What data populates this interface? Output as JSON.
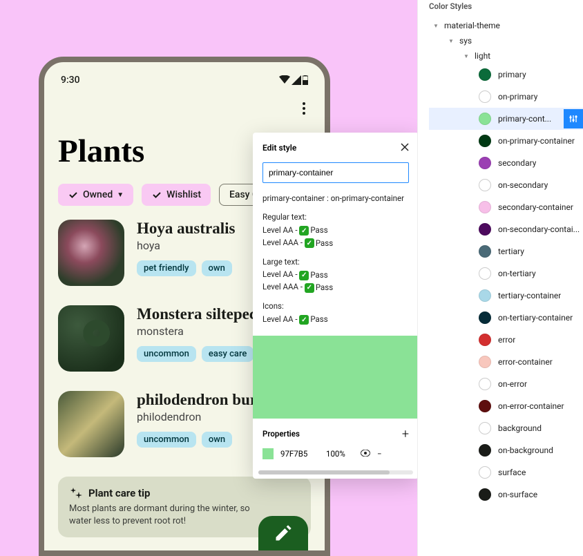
{
  "phone": {
    "time": "9:30",
    "title": "Plants",
    "chips": {
      "owned": "Owned",
      "wishlist": "Wishlist",
      "easy": "Easy C"
    },
    "items": [
      {
        "title": "Hoya australis",
        "sub": "hoya",
        "tags": [
          "pet friendly",
          "own"
        ]
      },
      {
        "title": "Monstera siltepeca",
        "sub": "monstera",
        "tags": [
          "uncommon",
          "easy care"
        ]
      },
      {
        "title": "philodendron bur",
        "sub": "philodendron",
        "tags": [
          "uncommon",
          "own"
        ]
      }
    ],
    "tip": {
      "head": "Plant care tip",
      "body": "Most plants are dormant during the winter, so water less to prevent root rot!"
    }
  },
  "panel": {
    "title": "Edit style",
    "input_value": "primary-container",
    "pair": "primary-container : on-primary-container",
    "regular_label": "Regular text:",
    "large_label": "Large text:",
    "icons_label": "Icons:",
    "aa_label": "Level AA - ",
    "aaa_label": "Level AAA - ",
    "pass_text": "Pass",
    "props_title": "Properties",
    "hex": "97F7B5",
    "opacity": "100%",
    "swatch_color": "#8ae296"
  },
  "sidebar": {
    "title": "Color Styles",
    "tree": {
      "root": "material-theme",
      "sys": "sys",
      "light": "light"
    },
    "colors": [
      {
        "name": "primary",
        "hex": "#0b6b3a",
        "empty": false
      },
      {
        "name": "on-primary",
        "hex": "#ffffff",
        "empty": true
      },
      {
        "name": "primary-cont...",
        "hex": "#8ae296",
        "empty": false,
        "selected": true
      },
      {
        "name": "on-primary-container",
        "hex": "#003913",
        "empty": false
      },
      {
        "name": "secondary",
        "hex": "#9b3fb3",
        "empty": false
      },
      {
        "name": "on-secondary",
        "hex": "#ffffff",
        "empty": true
      },
      {
        "name": "secondary-container",
        "hex": "#f7bfe8",
        "empty": false
      },
      {
        "name": "on-secondary-contai...",
        "hex": "#4d0a5e",
        "empty": false
      },
      {
        "name": "tertiary",
        "hex": "#4a6a77",
        "empty": false
      },
      {
        "name": "on-tertiary",
        "hex": "#ffffff",
        "empty": true
      },
      {
        "name": "tertiary-container",
        "hex": "#a9d8e8",
        "empty": false
      },
      {
        "name": "on-tertiary-container",
        "hex": "#062c38",
        "empty": false
      },
      {
        "name": "error",
        "hex": "#d32f2f",
        "empty": false
      },
      {
        "name": "error-container",
        "hex": "#f8c7bd",
        "empty": false
      },
      {
        "name": "on-error",
        "hex": "#ffffff",
        "empty": true
      },
      {
        "name": "on-error-container",
        "hex": "#5e0e0e",
        "empty": false
      },
      {
        "name": "background",
        "hex": "#ffffff",
        "empty": true
      },
      {
        "name": "on-background",
        "hex": "#1a1c18",
        "empty": false
      },
      {
        "name": "surface",
        "hex": "#ffffff",
        "empty": true
      },
      {
        "name": "on-surface",
        "hex": "#1a1c18",
        "empty": false
      }
    ]
  }
}
